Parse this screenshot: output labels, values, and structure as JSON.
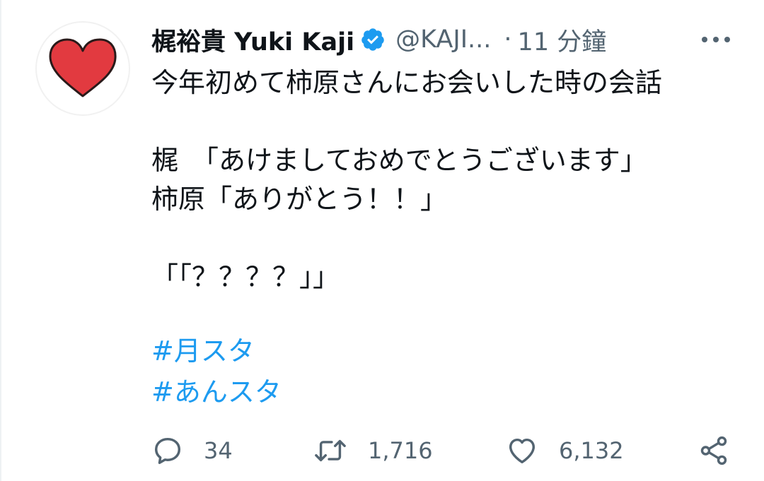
{
  "tweet": {
    "display_name": "梶裕貴 Yuki Kaji",
    "handle": "@KAJI...",
    "separator": "·",
    "time": "11 分鐘",
    "body": "今年初めて柿原さんにお会いした時の会話\n\n梶　「あけましておめでとうございます」\n柿原「ありがとう！！」\n\n「「？？？？」」",
    "hashtags": [
      "#月スタ",
      "#あんスタ"
    ],
    "counts": {
      "replies": "34",
      "retweets": "1,716",
      "likes": "6,132"
    }
  },
  "colors": {
    "link": "#1d9bf0",
    "muted": "#536471",
    "verified": "#1d9bf0",
    "heart_avatar": "#e23a40"
  },
  "icons": {
    "avatar": "red-heart-drawing",
    "verified": "verified-badge-icon",
    "more": "more-dots-icon",
    "reply": "reply-bubble-icon",
    "retweet": "retweet-icon",
    "like": "heart-outline-icon",
    "share": "share-icon"
  }
}
